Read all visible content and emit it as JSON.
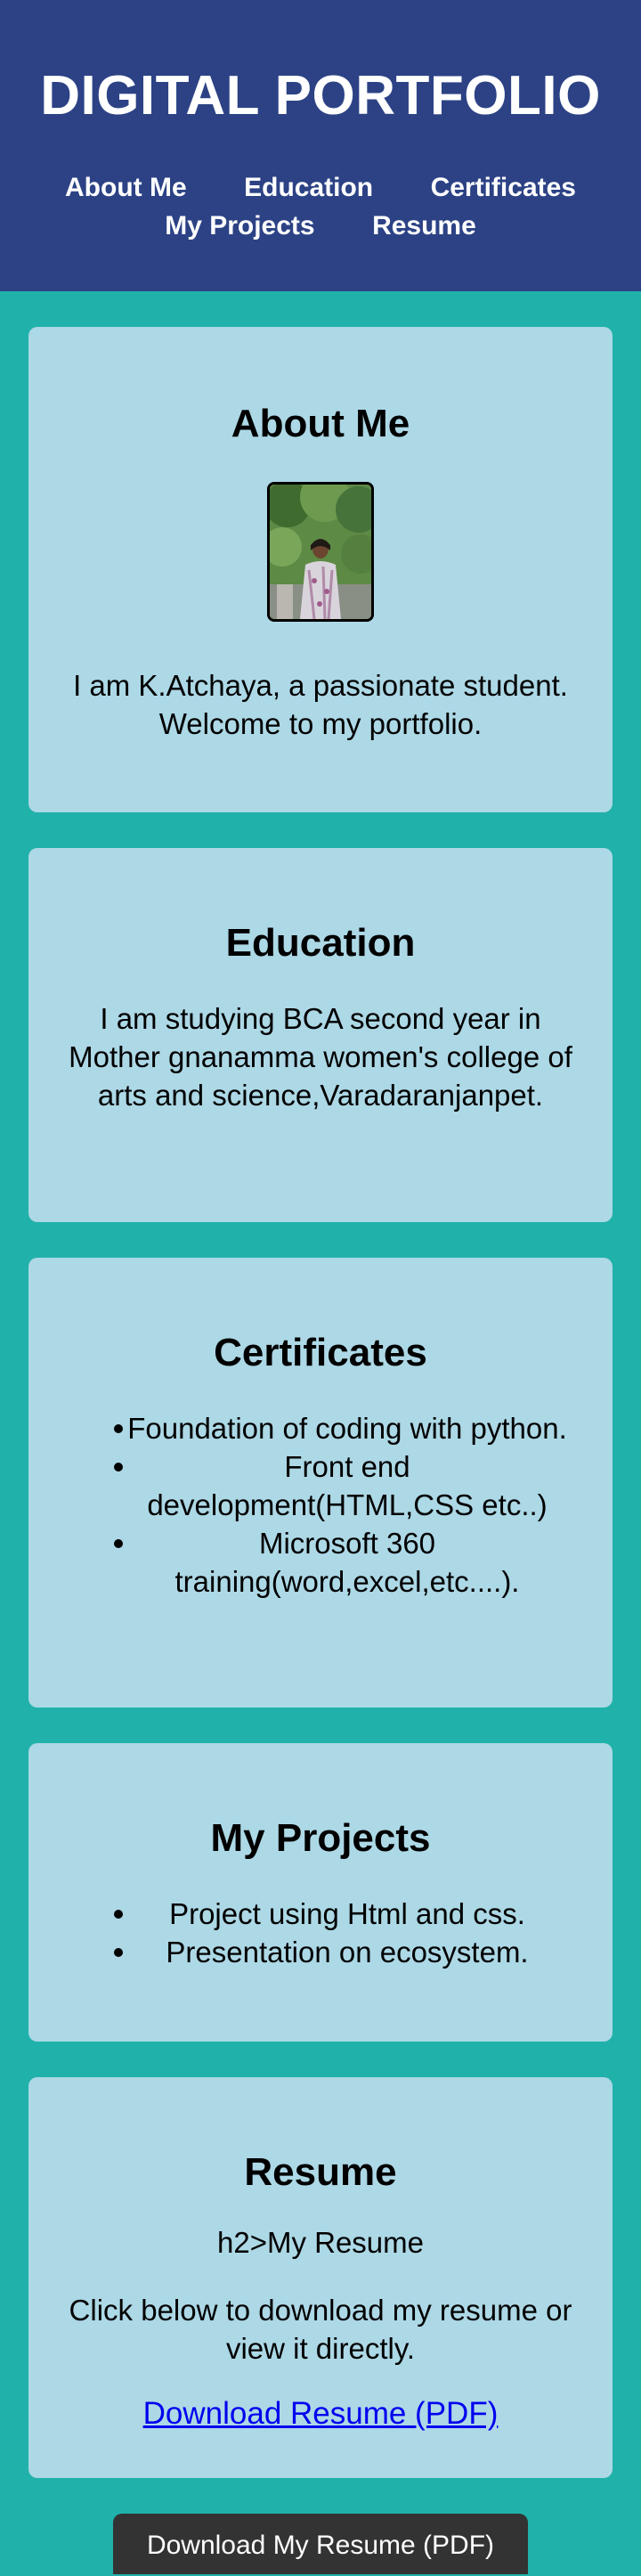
{
  "header": {
    "title": "DIGITAL PORTFOLIO",
    "nav": [
      "About Me",
      "Education",
      "Certificates",
      "My Projects",
      "Resume"
    ]
  },
  "about": {
    "heading": "About Me",
    "text": "I am K.Atchaya, a passionate student. Welcome to my portfolio."
  },
  "education": {
    "heading": "Education",
    "text": "I am studying BCA second year in Mother gnanamma women's college of arts and science,Varadaranjanpet."
  },
  "certificates": {
    "heading": "Certificates",
    "items": [
      "Foundation of coding with python.",
      "Front end development(HTML,CSS etc..)",
      "Microsoft 360 training(word,excel,etc....)."
    ]
  },
  "projects": {
    "heading": "My Projects",
    "items": [
      "Project using Html and css.",
      "Presentation on ecosystem."
    ]
  },
  "resume": {
    "heading": "Resume",
    "subheading": "h2>My Resume",
    "text": "Click below to download my resume or view it directly.",
    "link_label": "Download Resume (PDF)"
  },
  "download_button": "Download My Resume (PDF)",
  "colors": {
    "header_bg": "#2c4285",
    "page_bg": "#20b2aa",
    "card_bg": "#add8e6",
    "button_bg": "#333333",
    "link": "#0000ee"
  }
}
